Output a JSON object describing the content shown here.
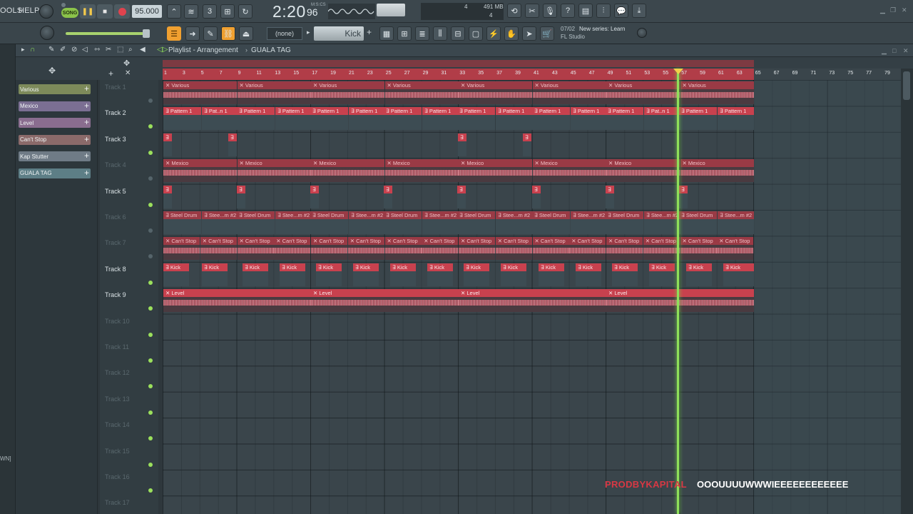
{
  "menu": {
    "tools": "OOLS",
    "help": "HELP"
  },
  "transport": {
    "mode_label": "SONG",
    "play_icon": "pause-icon",
    "tempo": "95.000",
    "time": "2:20",
    "time_frac": "96",
    "time_format": "M:S:CS",
    "cpu": "4",
    "memory": "491 MB",
    "polyphony": "4"
  },
  "toolbar2": {
    "pattern_select": "(none)",
    "channel_name": "Kick",
    "hint_date": "07/02",
    "hint_text": "New series: Learn",
    "hint_sub": "FL Studio"
  },
  "playlist": {
    "title": "Playlist - Arrangement",
    "arrangement": "GUALA TAG",
    "picker": [
      {
        "label": "Various",
        "color": "#7d8a5a"
      },
      {
        "label": "Mexico",
        "color": "#7b6f93"
      },
      {
        "label": "Level",
        "color": "#8a6d8f"
      },
      {
        "label": "Can't Stop",
        "color": "#8b6a6a"
      },
      {
        "label": "Kap Stutter",
        "color": "#6f7b86"
      },
      {
        "label": "GUALA TAG",
        "color": "#5d7e86"
      }
    ],
    "tracks": [
      {
        "name": "Track 1",
        "active": false
      },
      {
        "name": "Track 2",
        "active": true
      },
      {
        "name": "Track 3",
        "active": true
      },
      {
        "name": "Track 4",
        "active": false
      },
      {
        "name": "Track 5",
        "active": true
      },
      {
        "name": "Track 6",
        "active": false
      },
      {
        "name": "Track 7",
        "active": false
      },
      {
        "name": "Track 8",
        "active": true
      },
      {
        "name": "Track 9",
        "active": true
      },
      {
        "name": "Track 10",
        "active": false
      },
      {
        "name": "Track 11",
        "active": false
      },
      {
        "name": "Track 12",
        "active": false
      },
      {
        "name": "Track 13",
        "active": false
      },
      {
        "name": "Track 14",
        "active": false
      },
      {
        "name": "Track 15",
        "active": false
      },
      {
        "name": "Track 16",
        "active": false
      },
      {
        "name": "Track 17",
        "active": false
      }
    ],
    "bars": [
      "1",
      "3",
      "5",
      "7",
      "9",
      "11",
      "13",
      "15",
      "17",
      "19",
      "21",
      "23",
      "25",
      "27",
      "29",
      "31",
      "33",
      "35",
      "37",
      "39",
      "41",
      "43",
      "45",
      "47",
      "49",
      "51",
      "53",
      "55",
      "57",
      "59",
      "61",
      "63",
      "65",
      "67",
      "69",
      "71",
      "73",
      "75",
      "77",
      "79"
    ],
    "clips": {
      "t1": "Various",
      "t2a": "Pattern 1",
      "t2b": "Pat..n 1",
      "t4": "Mexico",
      "t6a": "Steel Drum",
      "t6b": "Stee...m #2",
      "t7": "Can't Stop",
      "t8": "Kick",
      "t9": "Level"
    },
    "browser_edge": "WN]"
  },
  "caption": {
    "left": "PRODBYKAPITAL",
    "right": "OOOUUUUWWWIEEEEEEEEEEEE"
  },
  "colors": {
    "clip": "#c8414e",
    "playhead": "#8fe05a",
    "accent": "#f0a030"
  }
}
